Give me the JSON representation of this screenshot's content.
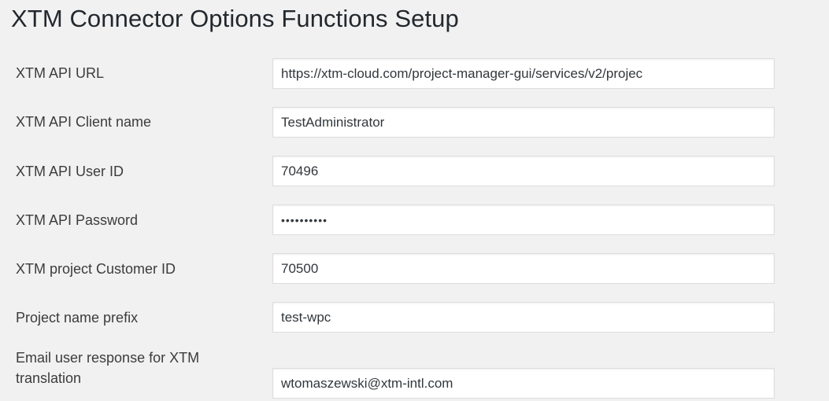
{
  "page": {
    "title": "XTM Connector Options Functions Setup"
  },
  "fields": {
    "api_url": {
      "label": "XTM API URL",
      "value": "https://xtm-cloud.com/project-manager-gui/services/v2/projec"
    },
    "client_name": {
      "label": "XTM API Client name",
      "value": "TestAdministrator"
    },
    "user_id": {
      "label": "XTM API User ID",
      "value": "70496"
    },
    "password": {
      "label": "XTM API Password",
      "value": "••••••••••"
    },
    "customer_id": {
      "label": "XTM project Customer ID",
      "value": "70500"
    },
    "name_prefix": {
      "label": "Project name prefix",
      "value": "test-wpc"
    },
    "email": {
      "label": "Email user response for XTM translation",
      "value": "wtomaszewski@xtm-intl.com"
    }
  }
}
